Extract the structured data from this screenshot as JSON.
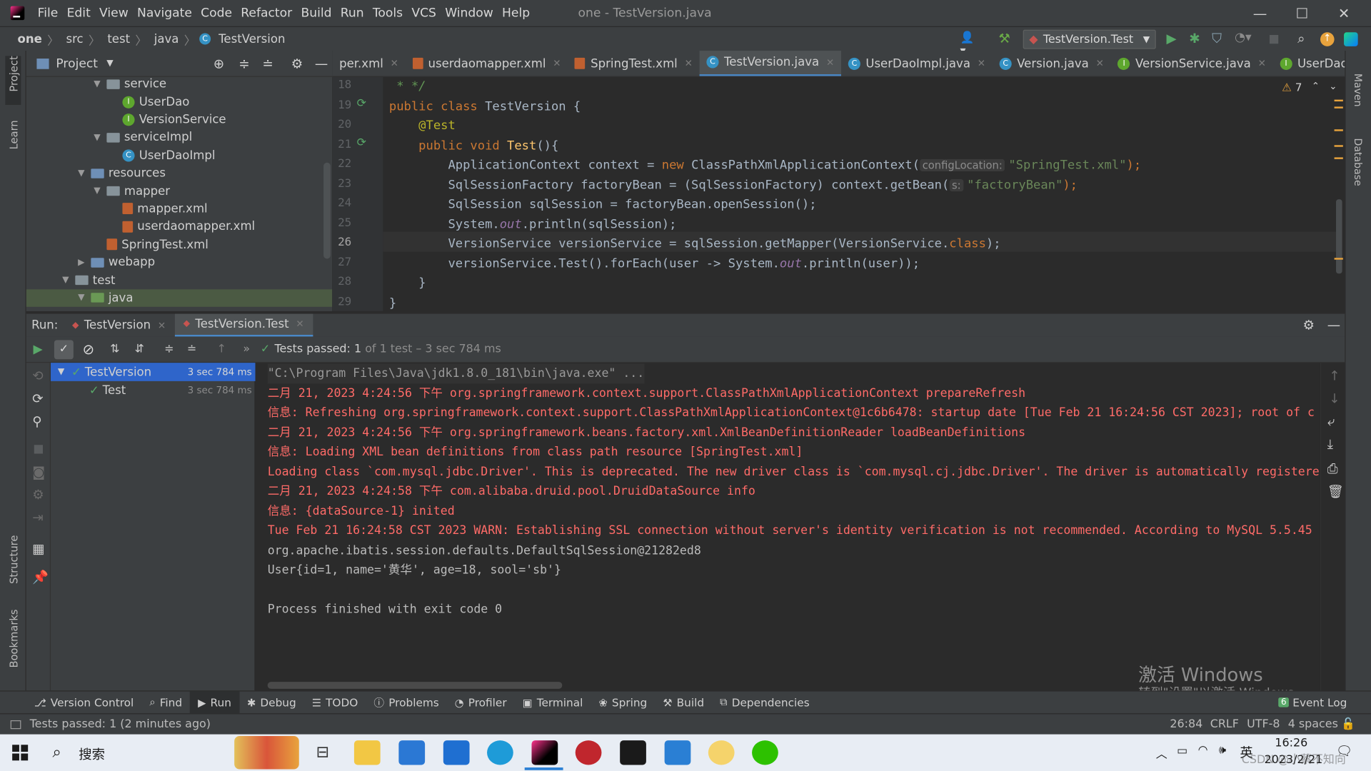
{
  "window": {
    "menus": [
      "File",
      "Edit",
      "View",
      "Navigate",
      "Code",
      "Refactor",
      "Build",
      "Run",
      "Tools",
      "VCS",
      "Window",
      "Help"
    ],
    "title": "one - TestVersion.java"
  },
  "breadcrumb": [
    "one",
    "src",
    "test",
    "java",
    "TestVersion"
  ],
  "run_config": "TestVersion.Test",
  "project_panel": {
    "title": "Project",
    "tree": [
      {
        "label": "service",
        "depth": 2,
        "type": "folder",
        "expanded": true
      },
      {
        "label": "UserDao",
        "depth": 3,
        "type": "iface"
      },
      {
        "label": "VersionService",
        "depth": 3,
        "type": "iface"
      },
      {
        "label": "serviceImpl",
        "depth": 2,
        "type": "folder",
        "expanded": true
      },
      {
        "label": "UserDaoImpl",
        "depth": 3,
        "type": "cls"
      },
      {
        "label": "resources",
        "depth": 1,
        "type": "folder",
        "expanded": true
      },
      {
        "label": "mapper",
        "depth": 2,
        "type": "folder",
        "expanded": true
      },
      {
        "label": "mapper.xml",
        "depth": 3,
        "type": "xml"
      },
      {
        "label": "userdaomapper.xml",
        "depth": 3,
        "type": "xml"
      },
      {
        "label": "SpringTest.xml",
        "depth": 2,
        "type": "xml"
      },
      {
        "label": "webapp",
        "depth": 1,
        "type": "folder",
        "expanded": false
      },
      {
        "label": "test",
        "depth": 0,
        "type": "folder",
        "expanded": true
      },
      {
        "label": "java",
        "depth": 1,
        "type": "folder-green",
        "expanded": true,
        "selected": true
      }
    ]
  },
  "editor_tabs": [
    {
      "label": "per.xml",
      "icon": "xml"
    },
    {
      "label": "userdaomapper.xml",
      "icon": "xml"
    },
    {
      "label": "SpringTest.xml",
      "icon": "xml"
    },
    {
      "label": "TestVersion.java",
      "icon": "cls",
      "active": true
    },
    {
      "label": "UserDaoImpl.java",
      "icon": "cls"
    },
    {
      "label": "Version.java",
      "icon": "cls"
    },
    {
      "label": "VersionService.java",
      "icon": "iface"
    },
    {
      "label": "UserDao.java",
      "icon": "iface"
    }
  ],
  "editor": {
    "warnings": "7",
    "line_numbers": [
      "18",
      "19",
      "20",
      "21",
      "22",
      "23",
      "24",
      "25",
      "26",
      "27",
      "28",
      "29"
    ],
    "code": {
      "l18": " * */",
      "l19_kw": "public class ",
      "l19_rest": "TestVersion {",
      "l20": "    @Test",
      "l21_kw": "    public void ",
      "l21_fn": "Test",
      "l21_rest": "(){",
      "l22_a": "        ApplicationContext context = ",
      "l22_kw": "new ",
      "l22_b": "ClassPathXmlApplicationContext(",
      "l22_hint": "configLocation:",
      "l22_str": "\"SpringTest.xml\"",
      "l22_end": ");",
      "l23_a": "        SqlSessionFactory factoryBean = (SqlSessionFactory) context.getBean(",
      "l23_hint": "s:",
      "l23_str": "\"factoryBean\"",
      "l23_end": ");",
      "l24": "        SqlSession sqlSession = factoryBean.openSession();",
      "l25_a": "        System.",
      "l25_it": "out",
      "l25_b": ".println(sqlSession);",
      "l26_a": "        VersionService versionService = sqlSession.getMapper(VersionService.",
      "l26_kw": "class",
      "l26_end": ");",
      "l27_a": "        versionService.Test().forEach(user -> System.",
      "l27_it": "out",
      "l27_b": ".println(user));",
      "l28": "    }",
      "l29": "}"
    }
  },
  "run_panel": {
    "label": "Run:",
    "tabs": [
      "TestVersion",
      "TestVersion.Test"
    ],
    "status_prefix": "Tests passed:",
    "status_count": "1",
    "status_suffix": "of 1 test – 3 sec 784 ms",
    "tree": [
      {
        "label": "TestVersion",
        "time": "3 sec 784 ms"
      },
      {
        "label": "Test",
        "time": "3 sec 784 ms"
      }
    ],
    "console": [
      {
        "text": "\"C:\\Program Files\\Java\\jdk1.8.0_181\\bin\\java.exe\" ...",
        "style": "dim"
      },
      {
        "text": "二月 21, 2023 4:24:56 下午 org.springframework.context.support.ClassPathXmlApplicationContext prepareRefresh",
        "style": "red"
      },
      {
        "text": "信息: Refreshing org.springframework.context.support.ClassPathXmlApplicationContext@1c6b6478: startup date [Tue Feb 21 16:24:56 CST 2023]; root of c",
        "style": "red"
      },
      {
        "text": "二月 21, 2023 4:24:56 下午 org.springframework.beans.factory.xml.XmlBeanDefinitionReader loadBeanDefinitions",
        "style": "red"
      },
      {
        "text": "信息: Loading XML bean definitions from class path resource [SpringTest.xml]",
        "style": "red"
      },
      {
        "text": "Loading class `com.mysql.jdbc.Driver'. This is deprecated. The new driver class is `com.mysql.cj.jdbc.Driver'. The driver is automatically registere",
        "style": "red"
      },
      {
        "text": "二月 21, 2023 4:24:58 下午 com.alibaba.druid.pool.DruidDataSource info",
        "style": "red"
      },
      {
        "text": "信息: {dataSource-1} inited",
        "style": "red"
      },
      {
        "text": "Tue Feb 21 16:24:58 CST 2023 WARN: Establishing SSL connection without server's identity verification is not recommended. According to MySQL 5.5.45",
        "style": "red"
      },
      {
        "text": "org.apache.ibatis.session.defaults.DefaultSqlSession@21282ed8",
        "style": "grey"
      },
      {
        "text": "User{id=1, name='黄华', age=18, sool='sb'}",
        "style": "grey"
      },
      {
        "text": "",
        "style": "grey"
      },
      {
        "text": "Process finished with exit code 0",
        "style": "grey"
      }
    ]
  },
  "left_strip": [
    "Project",
    "Learn",
    "Structure",
    "Bookmarks"
  ],
  "right_strip": [
    "Maven",
    "Database"
  ],
  "bottom_tabs": [
    "Version Control",
    "Find",
    "Run",
    "Debug",
    "TODO",
    "Problems",
    "Profiler",
    "Terminal",
    "Spring",
    "Build",
    "Dependencies"
  ],
  "event_log": {
    "count": "6",
    "label": "Event Log"
  },
  "status": {
    "message": "Tests passed: 1 (2 minutes ago)",
    "position": "26:84",
    "line_sep": "CRLF",
    "encoding": "UTF-8",
    "indent": "4 spaces"
  },
  "watermark": {
    "line1": "激活 Windows",
    "line2": "转到\"设置\"以激活 Windows。"
  },
  "taskbar": {
    "search": "搜索",
    "ime": "英",
    "time": "16:26",
    "date": "2023/2/21",
    "csdn": "CSDN @小蔡不知向"
  }
}
